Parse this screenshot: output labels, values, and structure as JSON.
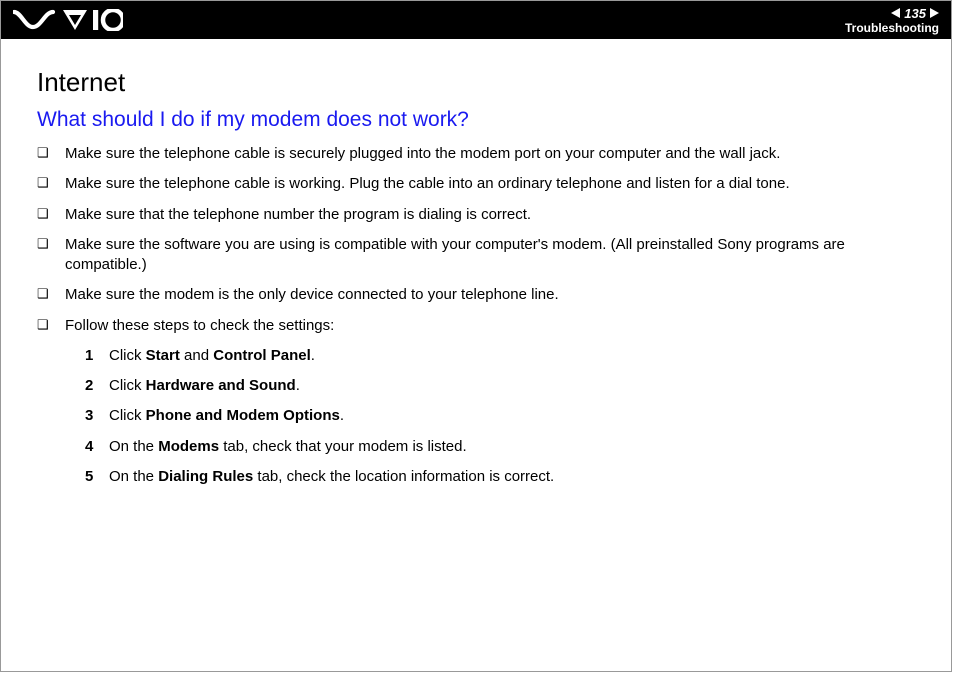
{
  "header": {
    "page_number": "135",
    "section_link": "Troubleshooting"
  },
  "content": {
    "section_title": "Internet",
    "question": "What should I do if my modem does not work?",
    "bullets": [
      "Make sure the telephone cable is securely plugged into the modem port on your computer and the wall jack.",
      "Make sure the telephone cable is working. Plug the cable into an ordinary telephone and listen for a dial tone.",
      "Make sure that the telephone number the program is dialing is correct.",
      "Make sure the software you are using is compatible with your computer's modem. (All preinstalled Sony programs are compatible.)",
      "Make sure the modem is the only device connected to your telephone line.",
      "Follow these steps to check the settings:"
    ],
    "steps": [
      {
        "n": "1",
        "pre": "Click ",
        "bold1": "Start",
        "mid": " and ",
        "bold2": "Control Panel",
        "post": "."
      },
      {
        "n": "2",
        "pre": "Click ",
        "bold1": "Hardware and Sound",
        "mid": "",
        "bold2": "",
        "post": "."
      },
      {
        "n": "3",
        "pre": "Click ",
        "bold1": "Phone and Modem Options",
        "mid": "",
        "bold2": "",
        "post": "."
      },
      {
        "n": "4",
        "pre": "On the ",
        "bold1": "Modems",
        "mid": " tab, check that your modem is listed.",
        "bold2": "",
        "post": ""
      },
      {
        "n": "5",
        "pre": "On the ",
        "bold1": "Dialing Rules",
        "mid": " tab, check the location information is correct.",
        "bold2": "",
        "post": ""
      }
    ]
  }
}
